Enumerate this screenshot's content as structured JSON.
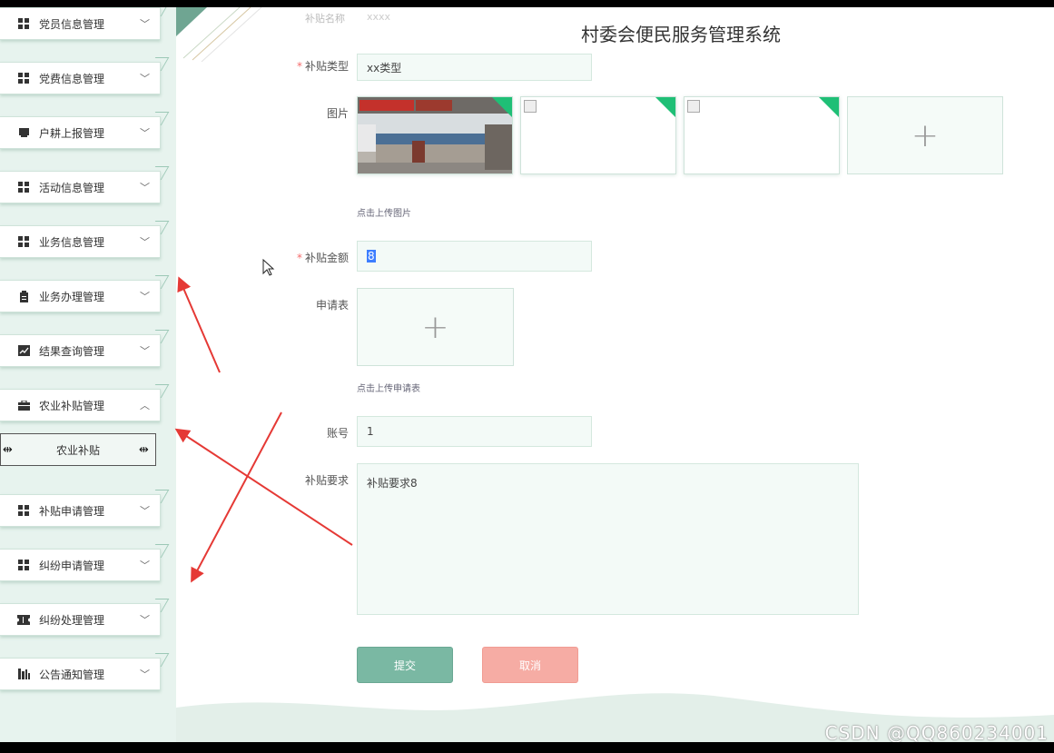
{
  "app": {
    "title": "村委会便民服务管理系统"
  },
  "top_faint": {
    "label": "补贴名称",
    "value": "xxxx"
  },
  "sidebar": {
    "items": [
      {
        "label": "党员信息管理",
        "icon": "grid-icon",
        "chevron": "﹀"
      },
      {
        "label": "党费信息管理",
        "icon": "grid-icon",
        "chevron": "﹀"
      },
      {
        "label": "户耕上报管理",
        "icon": "book-icon",
        "chevron": "﹀"
      },
      {
        "label": "活动信息管理",
        "icon": "grid-icon",
        "chevron": "﹀"
      },
      {
        "label": "业务信息管理",
        "icon": "grid-icon",
        "chevron": "﹀"
      },
      {
        "label": "业务办理管理",
        "icon": "clipboard-icon",
        "chevron": "﹀"
      },
      {
        "label": "结果查询管理",
        "icon": "chart-icon",
        "chevron": "﹀"
      },
      {
        "label": "农业补贴管理",
        "icon": "briefcase-icon",
        "chevron": "︿"
      },
      {
        "label": "补贴申请管理",
        "icon": "grid-icon",
        "chevron": "﹀"
      },
      {
        "label": "纠纷申请管理",
        "icon": "grid-icon",
        "chevron": "﹀"
      },
      {
        "label": "纠纷处理管理",
        "icon": "ticket-icon",
        "chevron": "﹀"
      },
      {
        "label": "公告通知管理",
        "icon": "bars-icon",
        "chevron": "﹀"
      }
    ],
    "sub_item": {
      "label": "农业补贴"
    }
  },
  "form": {
    "required_mark": "*",
    "subsidy_type": {
      "label": "补贴类型",
      "value": "xx类型"
    },
    "images": {
      "label": "图片",
      "hint": "点击上传图片",
      "plus": "+"
    },
    "amount": {
      "label": "补贴金额",
      "value": "8"
    },
    "application": {
      "label": "申请表",
      "hint": "点击上传申请表",
      "plus": "+"
    },
    "account": {
      "label": "账号",
      "value": "1"
    },
    "requirement": {
      "label": "补贴要求",
      "value": "补贴要求8"
    },
    "submit": "提交",
    "cancel": "取消"
  },
  "watermark": "CSDN @QQ860234001",
  "colors": {
    "accent": "#1fbf76",
    "sidebar_bg": "#e7f3ee",
    "submit": "#7ab8a3",
    "cancel": "#f6aca4",
    "annotation_arrow": "#e53935"
  }
}
